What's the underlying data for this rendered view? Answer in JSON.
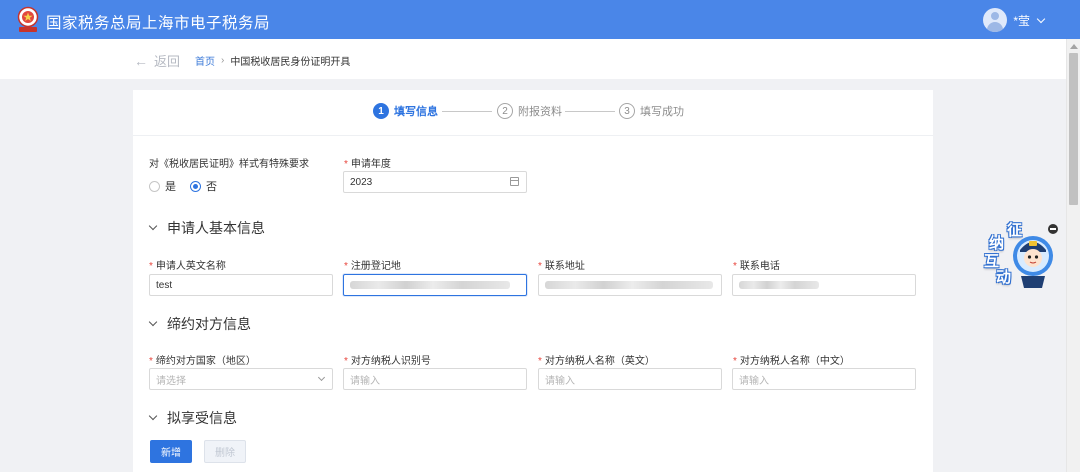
{
  "header": {
    "title": "国家税务总局上海市电子税务局",
    "user_name": "*莹",
    "brand_color": "#4a86e8"
  },
  "breadcrumb": {
    "back_label": "返回",
    "home_label": "首页",
    "separator": "›",
    "current_label": "中国税收居民身份证明开具"
  },
  "steps": [
    {
      "num": "1",
      "label": "填写信息",
      "state": "active"
    },
    {
      "num": "2",
      "label": "附报资料",
      "state": "idle"
    },
    {
      "num": "3",
      "label": "填写成功",
      "state": "idle"
    }
  ],
  "form": {
    "special_req_label": "对《税收居民证明》样式有特殊要求",
    "radio_yes": "是",
    "radio_no": "否",
    "radio_selected": "否",
    "year_label": "申请年度",
    "year_value": "2023",
    "required_mark": "*"
  },
  "applicant": {
    "section_title": "申请人基本信息",
    "english_name_label": "申请人英文名称",
    "english_name_value": "test",
    "reg_place_label": "注册登记地",
    "address_label": "联系地址",
    "phone_label": "联系电话"
  },
  "counterparty": {
    "section_title": "缔约对方信息",
    "country_label": "缔约对方国家（地区）",
    "country_placeholder": "请选择",
    "taxid_label": "对方纳税人识别号",
    "taxid_placeholder": "请输入",
    "name_en_label": "对方纳税人名称（英文）",
    "name_en_placeholder": "请输入",
    "name_cn_label": "对方纳税人名称（中文）",
    "name_cn_placeholder": "请输入"
  },
  "benefit": {
    "section_title": "拟享受信息",
    "add_button": "新增",
    "delete_button": "删除"
  },
  "widget": {
    "chars": [
      "征",
      "纳",
      "互",
      "动"
    ]
  },
  "colors": {
    "primary": "#2e74e0",
    "required": "#e8453c"
  }
}
